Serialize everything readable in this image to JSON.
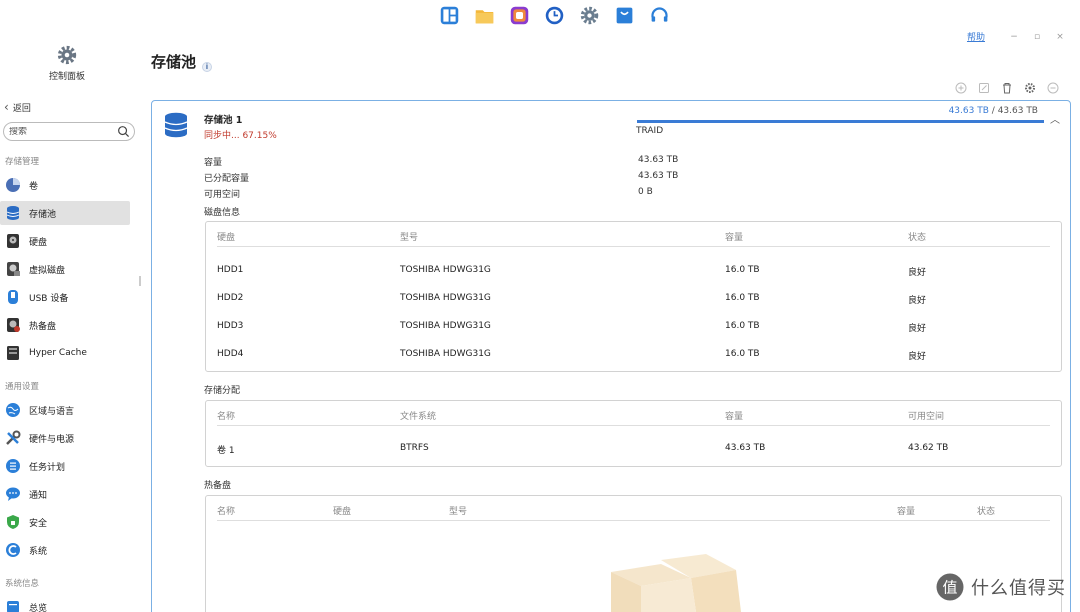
{
  "dock": {
    "apps": [
      {
        "name": "dashboard-app-icon",
        "color": "#2b7fd8"
      },
      {
        "name": "folder-app-icon",
        "color": "#f4b73a"
      },
      {
        "name": "photos-app-icon",
        "color": "#8a3ccf"
      },
      {
        "name": "clock-app-icon",
        "color": "#2160c4"
      },
      {
        "name": "settings-app-icon",
        "color": "#6a7d8f"
      },
      {
        "name": "store-app-icon",
        "color": "#2b7fd8"
      },
      {
        "name": "support-app-icon",
        "color": "#2b7fd8"
      }
    ]
  },
  "window": {
    "help": "帮助",
    "minimize": "−",
    "maximize": "▫",
    "close": "×"
  },
  "sidebar": {
    "app_title": "控制面板",
    "back": "返回",
    "search_placeholder": "搜索",
    "groups": [
      {
        "label": "存储管理",
        "items": [
          {
            "label": "卷",
            "icon": "pie-chart-icon",
            "active": false
          },
          {
            "label": "存储池",
            "icon": "database-icon",
            "active": true
          },
          {
            "label": "硬盘",
            "icon": "hard-drive-icon",
            "active": false
          },
          {
            "label": "虚拟磁盘",
            "icon": "virtual-disk-icon",
            "active": false
          },
          {
            "label": "USB 设备",
            "icon": "usb-icon",
            "active": false
          },
          {
            "label": "热备盘",
            "icon": "hot-spare-icon",
            "active": false
          },
          {
            "label": "Hyper Cache",
            "icon": "cache-icon",
            "active": false
          }
        ]
      },
      {
        "label": "通用设置",
        "items": [
          {
            "label": "区域与语言",
            "icon": "globe-icon",
            "active": false
          },
          {
            "label": "硬件与电源",
            "icon": "tools-icon",
            "active": false
          },
          {
            "label": "任务计划",
            "icon": "task-list-icon",
            "active": false
          },
          {
            "label": "通知",
            "icon": "chat-bubble-icon",
            "active": false
          },
          {
            "label": "安全",
            "icon": "shield-icon",
            "active": false
          },
          {
            "label": "系统",
            "icon": "system-icon",
            "active": false
          }
        ]
      },
      {
        "label": "系统信息",
        "items": [
          {
            "label": "总览",
            "icon": "overview-icon",
            "active": false
          }
        ]
      }
    ]
  },
  "page": {
    "title": "存储池",
    "info_icon": "i"
  },
  "pool": {
    "name": "存储池 1",
    "status": "同步中... 67.15%",
    "capacity_used": "43.63 TB",
    "capacity_sep": "/",
    "capacity_total": "43.63 TB",
    "usage_fraction": 1.0,
    "raid_type": "TRAID",
    "collapse_icon": "︿",
    "details": [
      {
        "label": "容量",
        "value": "43.63 TB"
      },
      {
        "label": "已分配容量",
        "value": "43.63 TB"
      },
      {
        "label": "可用空间",
        "value": "0 B"
      }
    ]
  },
  "disk_info": {
    "title": "磁盘信息",
    "headers": [
      "硬盘",
      "型号",
      "容量",
      "状态"
    ],
    "rows": [
      [
        "HDD1",
        "TOSHIBA HDWG31G",
        "16.0 TB",
        "良好"
      ],
      [
        "HDD2",
        "TOSHIBA HDWG31G",
        "16.0 TB",
        "良好"
      ],
      [
        "HDD3",
        "TOSHIBA HDWG31G",
        "16.0 TB",
        "良好"
      ],
      [
        "HDD4",
        "TOSHIBA HDWG31G",
        "16.0 TB",
        "良好"
      ]
    ]
  },
  "allocation": {
    "title": "存储分配",
    "headers": [
      "名称",
      "文件系统",
      "容量",
      "可用空间"
    ],
    "rows": [
      [
        "卷 1",
        "BTRFS",
        "43.63 TB",
        "43.62 TB"
      ]
    ]
  },
  "hot_spare": {
    "title": "热备盘",
    "headers": [
      "名称",
      "硬盘",
      "型号",
      "容量",
      "状态"
    ],
    "empty_icon": "empty-box-icon"
  },
  "watermark": {
    "logo": "值",
    "text": "什么值得买"
  }
}
